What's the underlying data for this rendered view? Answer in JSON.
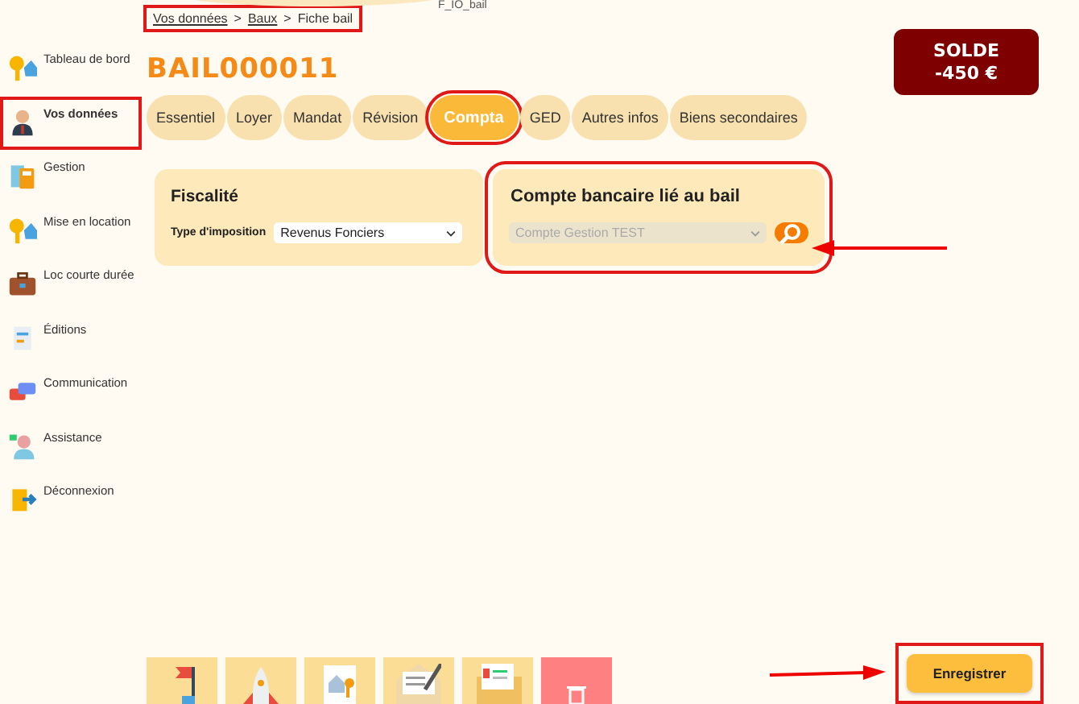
{
  "top_label": "F_IO_bail",
  "sidebar": {
    "items": [
      {
        "label": "Tableau de bord",
        "selected": false,
        "highlighted": false
      },
      {
        "label": "Vos données",
        "selected": true,
        "highlighted": true
      },
      {
        "label": "Gestion",
        "selected": false,
        "highlighted": false
      },
      {
        "label": "Mise en location",
        "selected": false,
        "highlighted": false
      },
      {
        "label": "Loc courte durée",
        "selected": false,
        "highlighted": false
      },
      {
        "label": "Éditions",
        "selected": false,
        "highlighted": false
      },
      {
        "label": "Communication",
        "selected": false,
        "highlighted": false
      },
      {
        "label": "Assistance",
        "selected": false,
        "highlighted": false
      },
      {
        "label": "Déconnexion",
        "selected": false,
        "highlighted": false
      }
    ]
  },
  "breadcrumb": {
    "highlighted": true,
    "items": [
      {
        "label": "Vos données"
      },
      {
        "label": "Baux"
      },
      {
        "label": "Fiche bail"
      }
    ],
    "separator": ">"
  },
  "title": "BAIL000011",
  "balance": {
    "label": "SOLDE",
    "amount": "-450 €"
  },
  "tabs": [
    {
      "label": "Essentiel",
      "selected": false,
      "highlighted": false
    },
    {
      "label": "Loyer",
      "selected": false,
      "highlighted": false
    },
    {
      "label": "Mandat",
      "selected": false,
      "highlighted": false
    },
    {
      "label": "Révision",
      "selected": false,
      "highlighted": false
    },
    {
      "label": "Compta",
      "selected": true,
      "highlighted": true
    },
    {
      "label": "GED",
      "selected": false,
      "highlighted": false
    },
    {
      "label": "Autres infos",
      "selected": false,
      "highlighted": false
    },
    {
      "label": "Biens secondaires",
      "selected": false,
      "highlighted": false
    }
  ],
  "fiscalite": {
    "title": "Fiscalité",
    "field_label": "Type d'imposition",
    "value": "Revenus Fonciers",
    "disabled": false
  },
  "bank_account": {
    "title": "Compte bancaire lié au bail",
    "value": "Compte Gestion TEST",
    "disabled": true,
    "highlighted": true
  },
  "bottom_tiles": [
    {
      "kind": "flag"
    },
    {
      "kind": "rocket"
    },
    {
      "kind": "house-key"
    },
    {
      "kind": "letter"
    },
    {
      "kind": "folder"
    },
    {
      "kind": "trash"
    }
  ],
  "save_button": {
    "label": "Enregistrer",
    "highlighted": true
  }
}
